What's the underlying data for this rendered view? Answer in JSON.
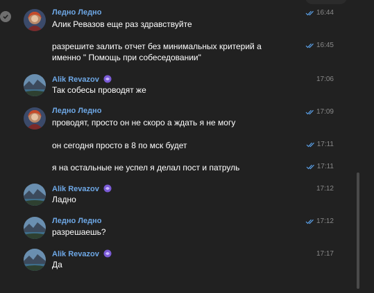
{
  "users": {
    "ledno": "Ледно Ледно",
    "alik": "Alik Revazov"
  },
  "messages": [
    {
      "author": "Ледно Ледно",
      "text": "Алик Ревазов еще раз здравствуйте",
      "time": "16:44",
      "read": true
    },
    {
      "author": "",
      "text_line1": "разрешите залить отчет без минимальных критерий а",
      "text_line2": "именно \" Помощь при собеседовании\"",
      "time": "16:45",
      "read": true
    },
    {
      "author": "Alik Revazov",
      "text": "Так собесы проводят же",
      "time": "17:06",
      "read": false
    },
    {
      "author": "Ледно Ледно",
      "text": "проводят, просто он не скоро а ждать я не могу",
      "time": "17:09",
      "read": true
    },
    {
      "author": "",
      "text": "он сегодня просто в 8 по мск будет",
      "time": "17:11",
      "read": true
    },
    {
      "author": "",
      "text": "я на остальные не успел я делал пост и патруль",
      "time": "17:11",
      "read": true
    },
    {
      "author": "Alik Revazov",
      "text": "Ладно",
      "time": "17:12",
      "read": false
    },
    {
      "author": "Ледно Ледно",
      "text": "разрешаешь?",
      "time": "17:12",
      "read": true
    },
    {
      "author": "Alik Revazov",
      "text": "Да",
      "time": "17:17",
      "read": false
    }
  ],
  "colors": {
    "background": "#212121",
    "name": "#6ea8e6",
    "check": "#5aa0e8",
    "time": "#8a8a8a"
  },
  "icons": {
    "select": "check-circle-icon",
    "read": "double-check-icon",
    "premium": "premium-emoji-icon"
  }
}
